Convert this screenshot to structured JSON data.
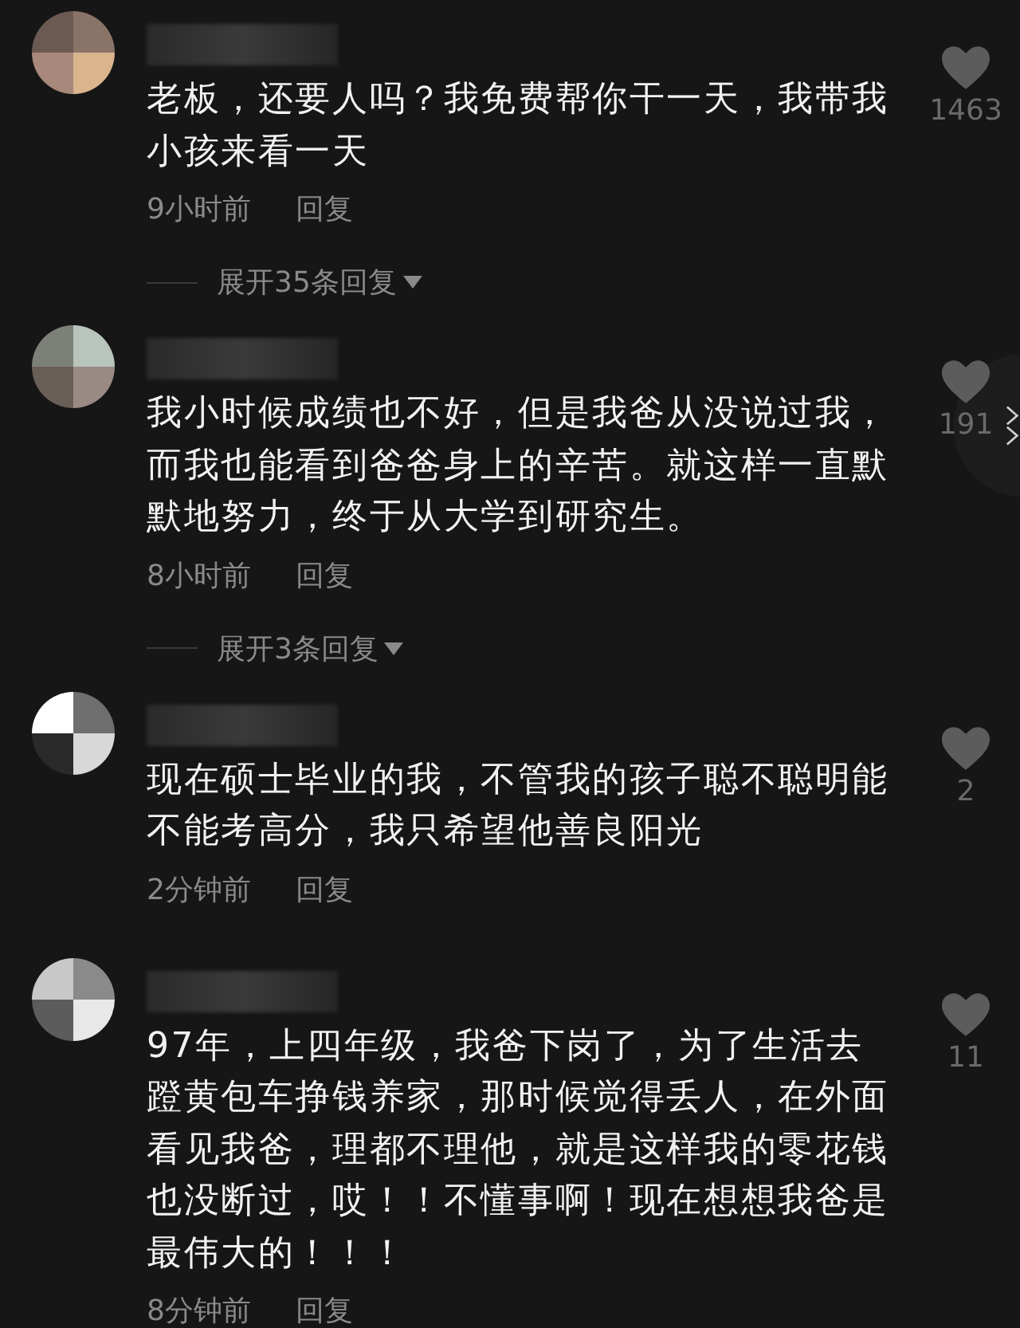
{
  "comments": [
    {
      "text": "老板，还要人吗？我免费帮你干一天，我带我小孩来看一天",
      "time": "9小时前",
      "reply": "回复",
      "likes": "1463",
      "expand": "展开35条回复"
    },
    {
      "text": "我小时候成绩也不好，但是我爸从没说过我，而我也能看到爸爸身上的辛苦。就这样一直默默地努力，终于从大学到研究生。",
      "time": "8小时前",
      "reply": "回复",
      "likes": "191",
      "expand": "展开3条回复"
    },
    {
      "text": "现在硕士毕业的我，不管我的孩子聪不聪明能不能考高分，我只希望他善良阳光",
      "time": "2分钟前",
      "reply": "回复",
      "likes": "2"
    },
    {
      "text": "97年，上四年级，我爸下岗了，为了生活去蹬黄包车挣钱养家，那时候觉得丢人，在外面看见我爸，理都不理他，就是这样我的零花钱也没断过，哎！！不懂事啊！现在想想我爸是最伟大的！！！",
      "time": "8分钟前",
      "reply": "回复",
      "likes": "11"
    }
  ]
}
